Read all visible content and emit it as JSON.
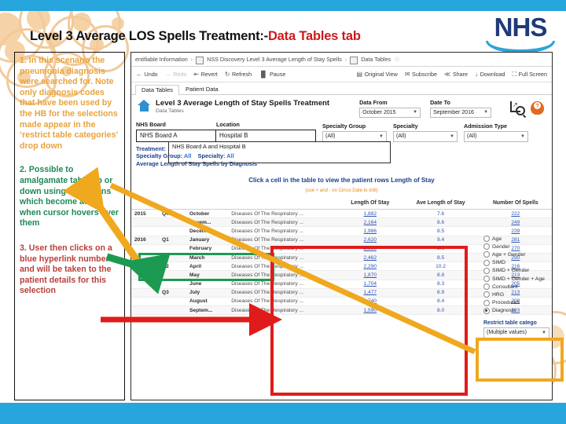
{
  "slide": {
    "title_main": "Level 3 Average LOS  Spells Treatment:-",
    "title_accent": "Data Tables tab",
    "logo": "NHS"
  },
  "notes": [
    {
      "id": "note-1",
      "color": "#e8a33d",
      "text": "1.  In this scenario the pneumonia diagnosis were searched for. Note only diagnosis codes that have been used by the HB for the selections made appear in the ‘restrict table categories’ drop down"
    },
    {
      "id": "note-2",
      "color": "#1d8a55",
      "text": "2. Possible to amalgamate table up or down using +/- buttons which become active when cursor hovers over them"
    },
    {
      "id": "note-3",
      "color": "#b8403a",
      "text": "3.   User then clicks on a blue hyperlink number and will be taken to the patient details for this selection"
    }
  ],
  "app": {
    "breadcrumb": [
      "entifiable Information",
      "NSS Discovery Level 3 Average Length of Stay Spells",
      "Data Tables"
    ],
    "toolbar_left": [
      {
        "label": "Undo",
        "icon": "undo-arrow-icon",
        "glyph": "←",
        "disabled": false
      },
      {
        "label": "Redo",
        "icon": "redo-arrow-icon",
        "glyph": "→",
        "disabled": true
      },
      {
        "label": "Revert",
        "icon": "revert-icon",
        "glyph": "⇤",
        "disabled": false
      },
      {
        "label": "Refresh",
        "icon": "refresh-icon",
        "glyph": "↻",
        "disabled": false
      },
      {
        "label": "Pause",
        "icon": "pause-icon",
        "glyph": "⏸",
        "disabled": false
      }
    ],
    "toolbar_right": [
      {
        "label": "Original View",
        "icon": "original-view-icon",
        "glyph": "▤"
      },
      {
        "label": "Subscribe",
        "icon": "subscribe-icon",
        "glyph": "✉"
      },
      {
        "label": "Share",
        "icon": "share-icon",
        "glyph": "≪"
      },
      {
        "label": "Download",
        "icon": "download-icon",
        "glyph": "↓"
      },
      {
        "label": "Full Screen",
        "icon": "fullscreen-icon",
        "glyph": "⛶"
      }
    ],
    "tabs": [
      {
        "label": "Data Tables",
        "active": true
      },
      {
        "label": "Patient Data",
        "active": false
      }
    ],
    "view_title": "Level 3 Average Length of Stay Spells Treatment",
    "view_subtitle": "Data Tables",
    "date_filters": [
      {
        "label": "Data From",
        "value": "October 2015"
      },
      {
        "label": "Date To",
        "value": "September 2016"
      }
    ],
    "filters": [
      {
        "label": "NHS Board",
        "value": "NHS Board A",
        "style": "highlight"
      },
      {
        "label": "Location",
        "value": "Hospital B",
        "style": "highlight"
      },
      {
        "label": "Specialty Group",
        "value": "(All)",
        "style": "select"
      },
      {
        "label": "Specialty",
        "value": "(All)",
        "style": "select"
      },
      {
        "label": "Admission Type",
        "value": "(All)",
        "style": "select"
      }
    ],
    "summary": {
      "treatment_label": "Treatment:",
      "treatment_value": "NHS Board A and Hospital B",
      "specialty_group_label": "Specialty Group:",
      "specialty_group_value": "All",
      "specialty_label": "Specialty:",
      "specialty_value": "All",
      "chart_title": "Average Length of Stay Spells by Diagnosis"
    },
    "hint_main": "Click a cell in the table to view the patient rows Length of Stay",
    "hint_sub": "(use + and - on Cirrus Date to drill)",
    "table": {
      "headers": [
        "",
        "",
        "",
        "",
        "Length Of Stay",
        "Ave Length of Stay",
        "Number Of Spells"
      ],
      "rows": [
        {
          "year": "2015",
          "quarter": "Q4",
          "month": "October",
          "diagnosis": "Diseases Of The Respiratory ...",
          "los": "1,882",
          "ave": "7.6",
          "spells": "222"
        },
        {
          "year": "",
          "quarter": "",
          "month": "Novem...",
          "diagnosis": "Diseases Of The Respiratory ...",
          "los": "2,164",
          "ave": "8.6",
          "spells": "249"
        },
        {
          "year": "",
          "quarter": "",
          "month": "Decem...",
          "diagnosis": "Diseases Of The Respiratory ...",
          "los": "1,986",
          "ave": "8.5",
          "spells": "239"
        },
        {
          "year": "2016",
          "quarter": "Q1",
          "month": "January",
          "diagnosis": "Diseases Of The Respiratory ...",
          "los": "2,620",
          "ave": "9.4",
          "spells": "281"
        },
        {
          "year": "",
          "quarter": "",
          "month": "February",
          "diagnosis": "Diseases Of The Respiratory ...",
          "los": "2,328",
          "ave": "8.6",
          "spells": "270"
        },
        {
          "year": "",
          "quarter": "",
          "month": "March",
          "diagnosis": "Diseases Of The Respiratory ...",
          "los": "2,462",
          "ave": "8.5",
          "spells": "290"
        },
        {
          "year": "",
          "quarter": "Q2",
          "month": "April",
          "diagnosis": "Diseases Of The Respiratory ...",
          "los": "2,290",
          "ave": "10.2",
          "spells": "216"
        },
        {
          "year": "",
          "quarter": "",
          "month": "May",
          "diagnosis": "Diseases Of The Respiratory ...",
          "los": "1,870",
          "ave": "8.8",
          "spells": "213"
        },
        {
          "year": "",
          "quarter": "",
          "month": "June",
          "diagnosis": "Diseases Of The Respiratory ...",
          "los": "1,704",
          "ave": "8.3",
          "spells": "205"
        },
        {
          "year": "",
          "quarter": "Q3",
          "month": "July",
          "diagnosis": "Diseases Of The Respiratory ...",
          "los": "1,477",
          "ave": "6.9",
          "spells": "213"
        },
        {
          "year": "",
          "quarter": "",
          "month": "August",
          "diagnosis": "Diseases Of The Respiratory ...",
          "los": "1,740",
          "ave": "8.4",
          "spells": "208"
        },
        {
          "year": "",
          "quarter": "",
          "month": "Septem...",
          "diagnosis": "Diseases Of The Respiratory ...",
          "los": "1,590",
          "ave": "8.0",
          "spells": "193"
        }
      ]
    },
    "options": {
      "items": [
        {
          "label": "Age",
          "selected": false
        },
        {
          "label": "Gender",
          "selected": false
        },
        {
          "label": "Age + Gender",
          "selected": false
        },
        {
          "label": "SIMD",
          "selected": false
        },
        {
          "label": "SIMD + Gender",
          "selected": false
        },
        {
          "label": "SIMD + Gender + Age",
          "selected": false
        },
        {
          "label": "Consultant",
          "selected": false
        },
        {
          "label": "HRG",
          "selected": false
        },
        {
          "label": "Procedures",
          "selected": false
        },
        {
          "label": "Diagnosis",
          "selected": true
        }
      ],
      "restrict_label": "Restrict table catego",
      "restrict_value": "(Multiple values)"
    }
  },
  "callouts": {
    "green_box": "amalgamate-plus-minus-target",
    "red_box": "hyperlink-numbers-target",
    "orange_box": "restrict-table-categories-target",
    "colors": {
      "green": "#1d9a52",
      "red": "#e01b1b",
      "orange": "#f0a81e"
    }
  }
}
